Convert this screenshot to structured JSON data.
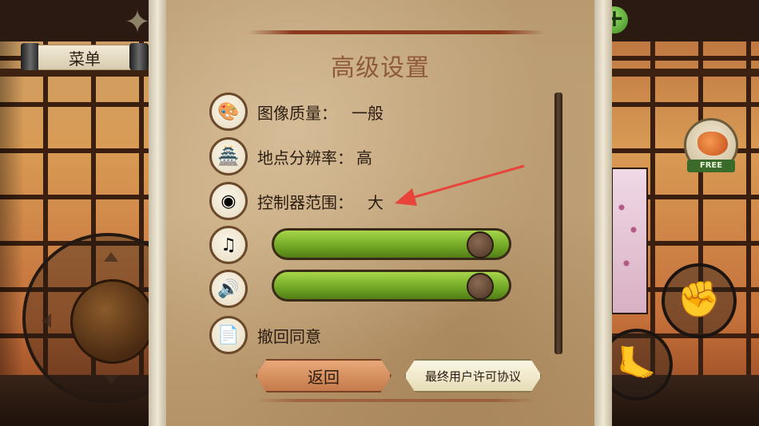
{
  "hud": {
    "menu_label": "菜单",
    "free_label": "FREE"
  },
  "dialog": {
    "title": "高级设置",
    "settings": [
      {
        "icon": "palette-icon",
        "label": "图像质量：",
        "value": "一般"
      },
      {
        "icon": "pagoda-icon",
        "label": "地点分辨率：",
        "value": "高"
      },
      {
        "icon": "controller-icon",
        "label": "控制器范围：",
        "value": "大"
      }
    ],
    "music_volume": 0.93,
    "sound_volume": 0.93,
    "revoke_label": "撤回同意",
    "back_button": "返回",
    "eula_button": "最终用户许可协议"
  },
  "colors": {
    "accent_red": "#8b3a1e",
    "slider_green": "#6fa524",
    "annotation_arrow": "#e8443a"
  }
}
